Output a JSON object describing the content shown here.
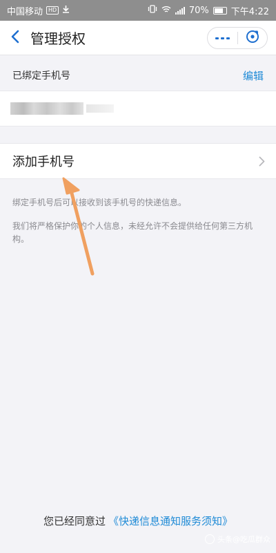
{
  "status_bar": {
    "carrier": "中国移动",
    "hd_badge": "HD",
    "battery": "70%",
    "time": "下午4:22"
  },
  "nav": {
    "title": "管理授权",
    "back_icon": "chevron-left-icon",
    "more_icon": "more-dots-icon",
    "close_icon": "close-circle-icon",
    "accent_color": "#1e6fd0"
  },
  "bound_section": {
    "header": "已绑定手机号",
    "edit_label": "编辑"
  },
  "add_phone": {
    "label": "添加手机号",
    "chevron_icon": "chevron-right-icon"
  },
  "notes": {
    "note1": "绑定手机号后可以接收到该手机号的快递信息。",
    "note2": "我们将严格保护你的个人信息，未经允许不会提供给任何第三方机构。"
  },
  "footer": {
    "prefix": "您已经同意过",
    "link": "《快递信息通知服务须知》",
    "link_color": "#1e8ad6"
  },
  "watermark": {
    "text": "头条@吃瓜群众"
  },
  "annotation": {
    "color": "#f0a060"
  }
}
